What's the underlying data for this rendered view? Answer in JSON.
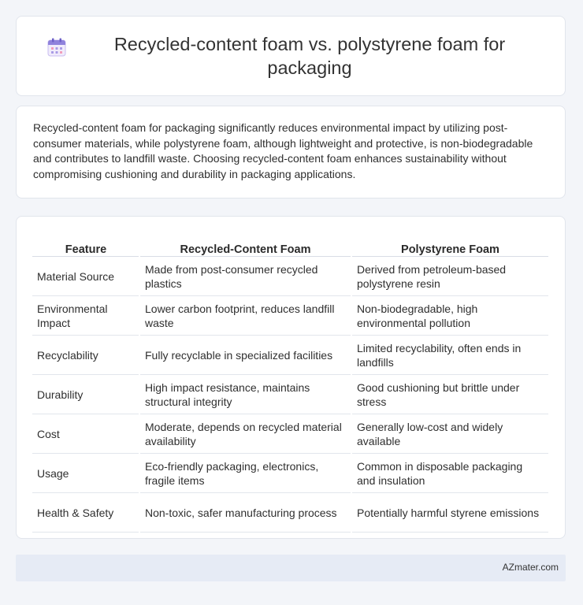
{
  "header": {
    "title": "Recycled-content foam vs. polystyrene foam for packaging",
    "icon": "calendar-icon"
  },
  "summary": {
    "text": "Recycled-content foam for packaging significantly reduces environmental impact by utilizing post-consumer materials, while polystyrene foam, although lightweight and protective, is non-biodegradable and contributes to landfill waste. Choosing recycled-content foam enhances sustainability without compromising cushioning and durability in packaging applications."
  },
  "table": {
    "headers": [
      "Feature",
      "Recycled-Content Foam",
      "Polystyrene Foam"
    ],
    "rows": [
      [
        "Material Source",
        "Made from post-consumer recycled plastics",
        "Derived from petroleum-based polystyrene resin"
      ],
      [
        "Environmental Impact",
        "Lower carbon footprint, reduces landfill waste",
        "Non-biodegradable, high environmental pollution"
      ],
      [
        "Recyclability",
        "Fully recyclable in specialized facilities",
        "Limited recyclability, often ends in landfills"
      ],
      [
        "Durability",
        "High impact resistance, maintains structural integrity",
        "Good cushioning but brittle under stress"
      ],
      [
        "Cost",
        "Moderate, depends on recycled material availability",
        "Generally low-cost and widely available"
      ],
      [
        "Usage",
        "Eco-friendly packaging, electronics, fragile items",
        "Common in disposable packaging and insulation"
      ],
      [
        "Health & Safety",
        "Non-toxic, safer manufacturing process",
        "Potentially harmful styrene emissions"
      ]
    ]
  },
  "footer": {
    "site": "AZmater.com"
  },
  "colors": {
    "background": "#f3f5f9",
    "footer_bg": "#e6ebf5",
    "icon_accent": "#8a7bd8"
  }
}
